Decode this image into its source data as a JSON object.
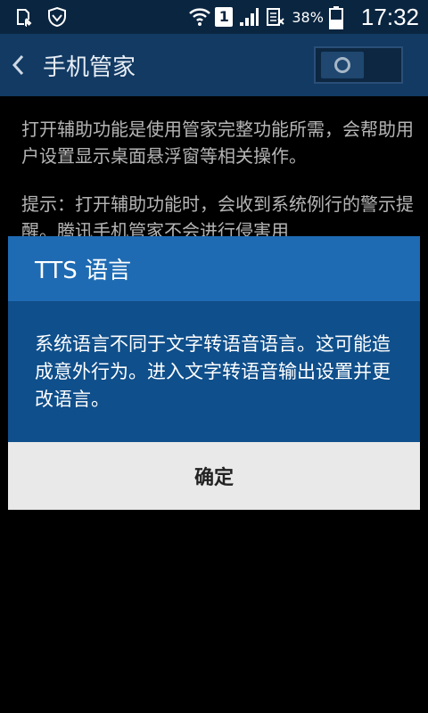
{
  "status_bar": {
    "sim_slot": "1",
    "battery_percent": "38%",
    "time": "17:32",
    "icons": [
      "download-status-icon",
      "shield-icon",
      "wifi-icon",
      "sim-slot-icon",
      "signal-icon",
      "roaming-icon",
      "battery-icon"
    ]
  },
  "app_bar": {
    "title": "手机管家",
    "toggle_on": false
  },
  "background_content": {
    "paragraph_1": "打开辅助功能是使用管家完整功能所需，会帮助用户设置显示桌面悬浮窗等相关操作。",
    "paragraph_2": "提示：打开辅助功能时，会收到系统例行的警示提醒。腾讯手机管家不会进行侵害用"
  },
  "dialog": {
    "title": "TTS 语言",
    "message": "系统语言不同于文字转语音语言。这可能造成意外行为。进入文字转语音输出设置并更改语言。",
    "confirm_label": "确定"
  }
}
